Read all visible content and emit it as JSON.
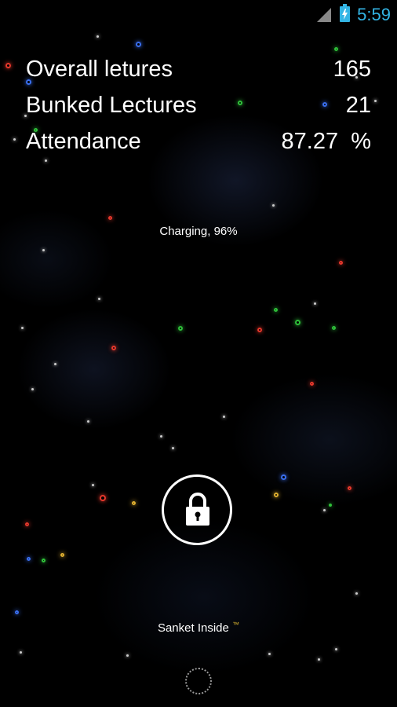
{
  "status_bar": {
    "time": "5:59",
    "signal_icon": "signal-icon",
    "battery_icon": "battery-charging-icon",
    "accent_color": "#33b5e5"
  },
  "stats": {
    "overall": {
      "label": "Overall letures",
      "value": "165"
    },
    "bunked": {
      "label": "Bunked Lectures",
      "value": "21"
    },
    "attendance": {
      "label": "Attendance",
      "value": "87.27  %"
    }
  },
  "charging_text": "Charging, 96%",
  "lock": {
    "icon": "lock-icon"
  },
  "footer": {
    "text": "Sanket Inside",
    "trademark": "™"
  },
  "colors": {
    "background": "#000000",
    "text": "#ffffff",
    "particle_red": "#e8382c",
    "particle_green": "#2fc23a",
    "particle_blue": "#3a6ff0",
    "particle_yellow": "#e0b030"
  }
}
